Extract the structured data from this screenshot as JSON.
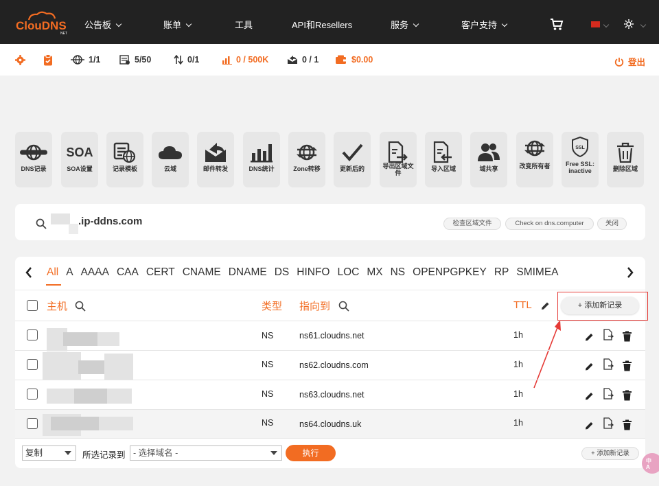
{
  "brand": {
    "logo": "ClouDNS",
    "logo_sub": "NET"
  },
  "nav": {
    "items": [
      "公告板",
      "账单",
      "工具",
      "API和Resellers",
      "服务",
      "客户支持"
    ]
  },
  "status": {
    "zones": "1/1",
    "records": "5/50",
    "transfers": "0/1",
    "queries": "0 / 500K",
    "mail": "0 / 1",
    "balance": "$0.00",
    "logout": "登出"
  },
  "tiles": [
    {
      "label": "DNS记录",
      "icon": "dns-globe"
    },
    {
      "label": "SOA设置",
      "icon": "soa-text"
    },
    {
      "label": "记录模板",
      "icon": "record-template"
    },
    {
      "label": "云域",
      "icon": "cloud"
    },
    {
      "label": "邮件转发",
      "icon": "mail-forward"
    },
    {
      "label": "DNS统计",
      "icon": "bar-chart"
    },
    {
      "label": "Zone转移",
      "icon": "zone-transfer"
    },
    {
      "label": "更新后的",
      "icon": "check"
    },
    {
      "label": "导出区域文件",
      "icon": "export-file"
    },
    {
      "label": "导入区域",
      "icon": "import-file"
    },
    {
      "label": "域共享",
      "icon": "users"
    },
    {
      "label": "改变所有者",
      "icon": "change-owner"
    },
    {
      "label": "Free SSL: inactive",
      "icon": "ssl-badge"
    },
    {
      "label": "删除区域",
      "icon": "trash"
    }
  ],
  "zone": {
    "domain": ".ip-ddns.com",
    "btn_check_zone": "检查区域文件",
    "btn_check_dns": "Check on dns.computer",
    "btn_close": "关闭"
  },
  "record_tabs": {
    "items": [
      "All",
      "A",
      "AAAA",
      "CAA",
      "CERT",
      "CNAME",
      "DNAME",
      "DS",
      "HINFO",
      "LOC",
      "MX",
      "NS",
      "OPENPGPKEY",
      "RP",
      "SMIMEA"
    ],
    "active": "All"
  },
  "table": {
    "headers": {
      "host": "主机",
      "type": "类型",
      "points_to": "指向到",
      "ttl": "TTL"
    },
    "add_button": "+ 添加新记录",
    "rows": [
      {
        "type": "NS",
        "value": "ns61.cloudns.net",
        "ttl": "1h"
      },
      {
        "type": "NS",
        "value": "ns62.cloudns.com",
        "ttl": "1h"
      },
      {
        "type": "NS",
        "value": "ns63.cloudns.net",
        "ttl": "1h"
      },
      {
        "type": "NS",
        "value": "ns64.cloudns.uk",
        "ttl": "1h"
      }
    ]
  },
  "footer": {
    "action_select": "复制",
    "to_label": "所选记录到",
    "domain_select": "- 选择域名 -",
    "execute": "执行",
    "add_button": "+ 添加新记录"
  },
  "colors": {
    "accent": "#f26c22",
    "nav_bg": "#222222",
    "annotation": "#e53935"
  }
}
